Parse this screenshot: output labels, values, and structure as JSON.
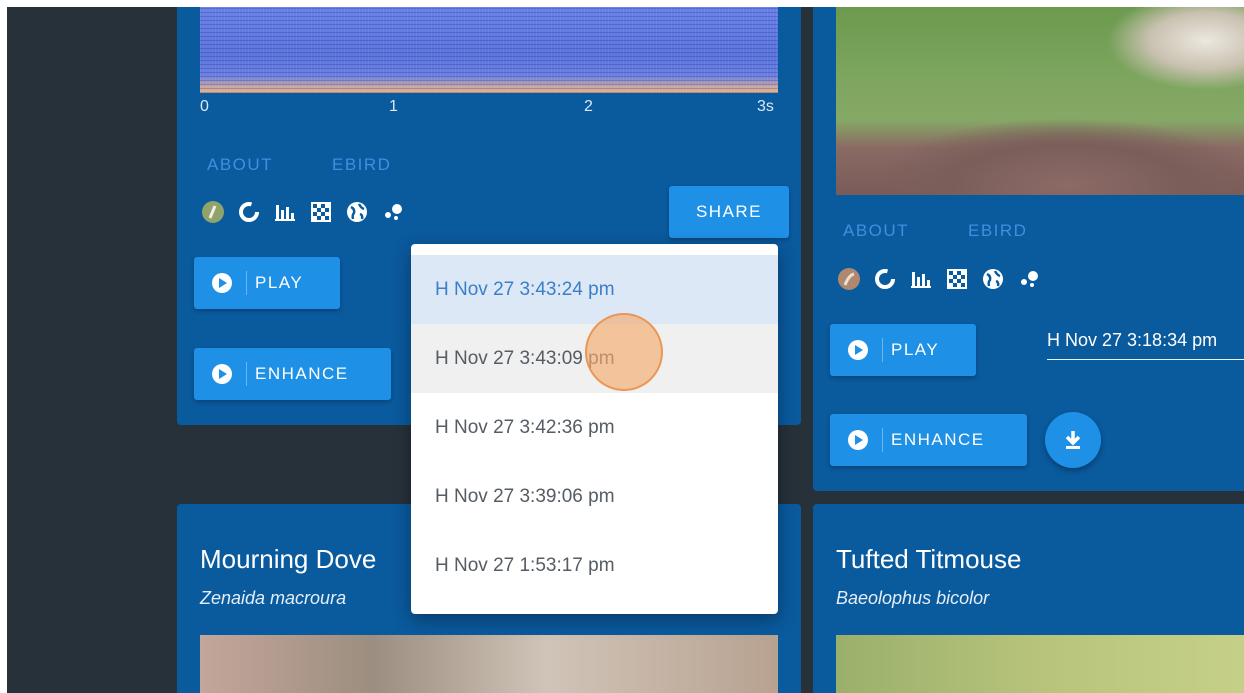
{
  "colors": {
    "app_background": "#26313a",
    "card_background": "#0a5a9e",
    "button_background": "#1e90e6",
    "link_color": "#3d8fe0",
    "menu_selected": "#dce8f6"
  },
  "card_top_left": {
    "spectrogram_ticks": [
      "0",
      "1",
      "2",
      "3s"
    ],
    "links": [
      "ABOUT",
      "EBIRD"
    ],
    "icons": [
      "bird-photo-icon",
      "donut-icon",
      "bar-chart-icon",
      "checker-grid-icon",
      "globe-icon",
      "scatter-dots-icon"
    ],
    "share_label": "SHARE",
    "play_label": "PLAY",
    "enhance_label": "ENHANCE"
  },
  "card_top_right": {
    "links": [
      "ABOUT",
      "EBIRD"
    ],
    "icons": [
      "bird-photo-icon",
      "donut-icon",
      "bar-chart-icon",
      "checker-grid-icon",
      "globe-icon",
      "scatter-dots-icon"
    ],
    "play_label": "PLAY",
    "enhance_label": "ENHANCE",
    "recording_select_value": "H Nov 27 3:18:34 pm"
  },
  "card_bottom_left": {
    "common_name": "Mourning Dove",
    "scientific_name": "Zenaida macroura"
  },
  "card_bottom_right": {
    "common_name": "Tufted Titmouse",
    "scientific_name": "Baeolophus bicolor"
  },
  "recording_menu": {
    "items": [
      "H Nov 27 3:43:24 pm",
      "H Nov 27 3:43:09 pm",
      "H Nov 27 3:42:36 pm",
      "H Nov 27 3:39:06 pm",
      "H Nov 27 1:53:17 pm"
    ],
    "selected_index": 0,
    "hovered_index": 1
  }
}
